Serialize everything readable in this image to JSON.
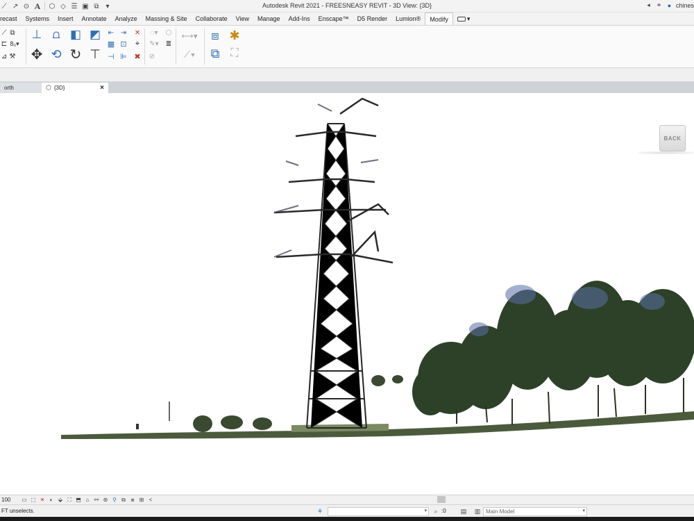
{
  "window": {
    "title": "Autodesk Revit 2021 - FREESNEASY REVIT - 3D View: {3D}",
    "user": "chines",
    "qat_text_tool": "A"
  },
  "ribbon": {
    "tabs": [
      {
        "label": "recast"
      },
      {
        "label": "Systems"
      },
      {
        "label": "Insert"
      },
      {
        "label": "Annotate"
      },
      {
        "label": "Analyze"
      },
      {
        "label": "Massing & Site"
      },
      {
        "label": "Collaborate"
      },
      {
        "label": "View"
      },
      {
        "label": "Manage"
      },
      {
        "label": "Add-Ins"
      },
      {
        "label": "Enscape™"
      },
      {
        "label": "D5 Render"
      },
      {
        "label": "Lumion®"
      },
      {
        "label": "Modify"
      }
    ],
    "active_tab": "Modify"
  },
  "view_tabs": {
    "inactive": "orth",
    "active": "{3D}",
    "close": "×"
  },
  "canvas": {
    "back_button": "BACK",
    "accent_colors": {
      "tower": "#2a2a2a",
      "trees": "#2e4a2a",
      "ground": "#4a5a3a",
      "sky_blue": "#5b6fa8"
    }
  },
  "view_control": {
    "scale": "100",
    "collapse": "<"
  },
  "status": {
    "message": "FT unselects.",
    "zero_value": ":0",
    "workset": "Main Model"
  }
}
